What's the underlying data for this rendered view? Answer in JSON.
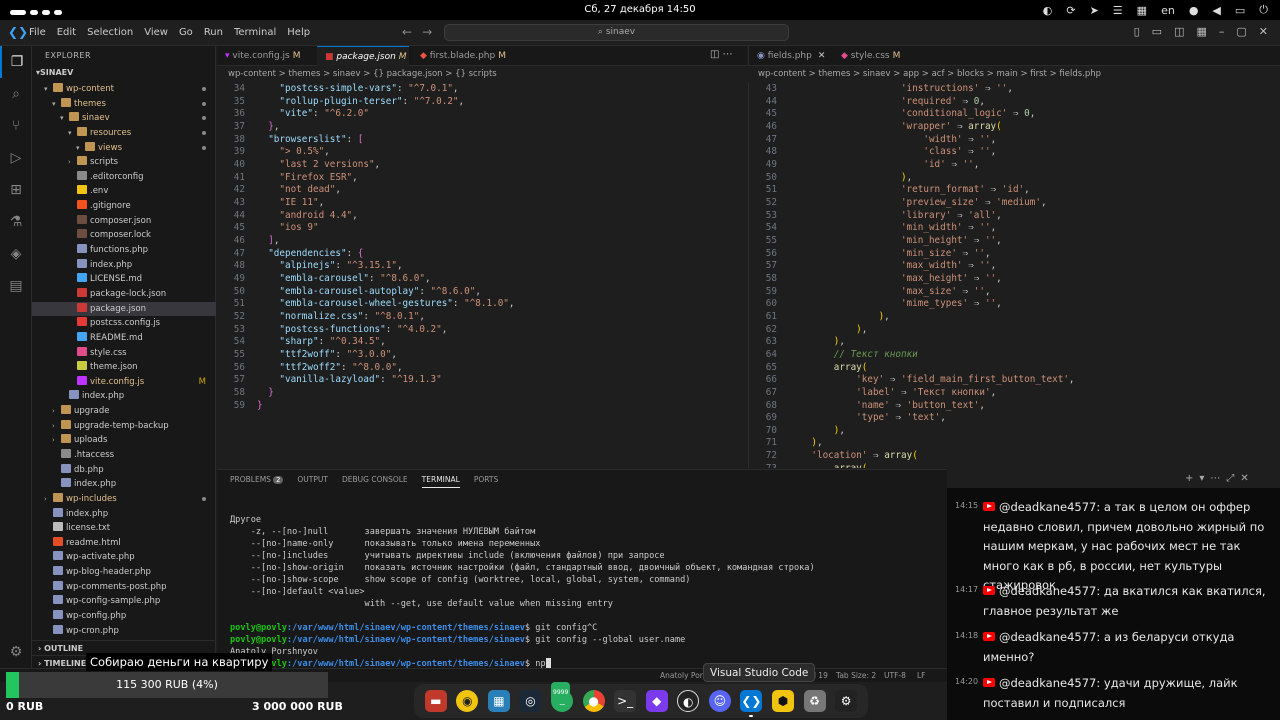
{
  "system": {
    "datetime": "Сб, 27 декабря 14:50",
    "lang": "en",
    "tray_icons": [
      "opera-icon",
      "refresh-icon",
      "telegram-icon",
      "equalizer-icon",
      "calendar-icon",
      "lang-indicator",
      "mic-icon",
      "volume-icon",
      "battery-icon",
      "power-icon"
    ]
  },
  "menubar": {
    "items": [
      "File",
      "Edit",
      "Selection",
      "View",
      "Go",
      "Run",
      "Terminal",
      "Help"
    ],
    "search": "sinaev"
  },
  "explorer": {
    "title": "EXPLORER",
    "root": "SINAEV",
    "rows": [
      {
        "label": "wp-content",
        "depth": 1,
        "type": "folder-open",
        "git": "mod",
        "dot": true
      },
      {
        "label": "themes",
        "depth": 2,
        "type": "folder-open",
        "git": "mod",
        "dot": true
      },
      {
        "label": "sinaev",
        "depth": 3,
        "type": "folder-open",
        "git": "mod",
        "dot": true
      },
      {
        "label": "resources",
        "depth": 4,
        "type": "folder-open",
        "git": "mod",
        "dot": true
      },
      {
        "label": "views",
        "depth": 5,
        "type": "folder-open",
        "git": "mod",
        "dot": true
      },
      {
        "label": "scripts",
        "depth": 4,
        "type": "folder",
        "git": ""
      },
      {
        "label": ".editorconfig",
        "depth": 4,
        "type": "file",
        "git": ""
      },
      {
        "label": ".env",
        "depth": 4,
        "type": "file-env",
        "git": ""
      },
      {
        "label": ".gitignore",
        "depth": 4,
        "type": "file-git",
        "git": ""
      },
      {
        "label": "composer.json",
        "depth": 4,
        "type": "file-composer",
        "git": ""
      },
      {
        "label": "composer.lock",
        "depth": 4,
        "type": "file-composer",
        "git": ""
      },
      {
        "label": "functions.php",
        "depth": 4,
        "type": "file-php",
        "git": ""
      },
      {
        "label": "index.php",
        "depth": 4,
        "type": "file-php",
        "git": ""
      },
      {
        "label": "LICENSE.md",
        "depth": 4,
        "type": "file-md",
        "git": ""
      },
      {
        "label": "package-lock.json",
        "depth": 4,
        "type": "file-npm",
        "git": ""
      },
      {
        "label": "package.json",
        "depth": 4,
        "type": "file-npm",
        "git": "",
        "selected": true
      },
      {
        "label": "postcss.config.js",
        "depth": 4,
        "type": "file-postcss",
        "git": ""
      },
      {
        "label": "README.md",
        "depth": 4,
        "type": "file-md",
        "git": ""
      },
      {
        "label": "style.css",
        "depth": 4,
        "type": "file-css",
        "git": ""
      },
      {
        "label": "theme.json",
        "depth": 4,
        "type": "file-json",
        "git": ""
      },
      {
        "label": "vite.config.js",
        "depth": 4,
        "type": "file-vite",
        "git": "mod",
        "mod": "M"
      },
      {
        "label": "index.php",
        "depth": 3,
        "type": "file-php",
        "git": ""
      },
      {
        "label": "upgrade",
        "depth": 2,
        "type": "folder",
        "git": ""
      },
      {
        "label": "upgrade-temp-backup",
        "depth": 2,
        "type": "folder",
        "git": ""
      },
      {
        "label": "uploads",
        "depth": 2,
        "type": "folder",
        "git": ""
      },
      {
        "label": ".htaccess",
        "depth": 2,
        "type": "file",
        "git": ""
      },
      {
        "label": "db.php",
        "depth": 2,
        "type": "file-php",
        "git": ""
      },
      {
        "label": "index.php",
        "depth": 2,
        "type": "file-php",
        "git": ""
      },
      {
        "label": "wp-includes",
        "depth": 1,
        "type": "folder",
        "git": "mod",
        "dot": true
      },
      {
        "label": "index.php",
        "depth": 1,
        "type": "file-php",
        "git": ""
      },
      {
        "label": "license.txt",
        "depth": 1,
        "type": "file-txt",
        "git": ""
      },
      {
        "label": "readme.html",
        "depth": 1,
        "type": "file-html",
        "git": ""
      },
      {
        "label": "wp-activate.php",
        "depth": 1,
        "type": "file-php",
        "git": ""
      },
      {
        "label": "wp-blog-header.php",
        "depth": 1,
        "type": "file-php",
        "git": ""
      },
      {
        "label": "wp-comments-post.php",
        "depth": 1,
        "type": "file-php",
        "git": ""
      },
      {
        "label": "wp-config-sample.php",
        "depth": 1,
        "type": "file-php",
        "git": ""
      },
      {
        "label": "wp-config.php",
        "depth": 1,
        "type": "file-php",
        "git": ""
      },
      {
        "label": "wp-cron.php",
        "depth": 1,
        "type": "file-php",
        "git": ""
      }
    ],
    "outline": "OUTLINE",
    "timeline": "TIMELINE"
  },
  "left_editor": {
    "tabs": [
      {
        "label": "vite.config.js",
        "mod": "M",
        "icon": "vite-icon"
      },
      {
        "label": "package.json",
        "mod": "M",
        "icon": "npm-icon",
        "active": true
      },
      {
        "label": "first.blade.php",
        "mod": "M",
        "icon": "blade-icon"
      }
    ],
    "breadcrumb": "wp-content > themes > sinaev > {} package.json > {} scripts",
    "lines": [
      {
        "n": "34",
        "t": "    \"postcss-simple-vars\": \"^7.0.1\","
      },
      {
        "n": "35",
        "t": "    \"rollup-plugin-terser\": \"^7.0.2\","
      },
      {
        "n": "36",
        "t": "    \"vite\": \"^6.2.0\""
      },
      {
        "n": "37",
        "t": "  },"
      },
      {
        "n": "38",
        "t": "  \"browserslist\": ["
      },
      {
        "n": "39",
        "t": "    \"> 0.5%\","
      },
      {
        "n": "40",
        "t": "    \"last 2 versions\","
      },
      {
        "n": "41",
        "t": "    \"Firefox ESR\","
      },
      {
        "n": "42",
        "t": "    \"not dead\","
      },
      {
        "n": "43",
        "t": "    \"IE 11\","
      },
      {
        "n": "44",
        "t": "    \"android 4.4\","
      },
      {
        "n": "45",
        "t": "    \"ios 9\""
      },
      {
        "n": "46",
        "t": "  ],"
      },
      {
        "n": "47",
        "t": "  \"dependencies\": {"
      },
      {
        "n": "48",
        "t": "    \"alpinejs\": \"^3.15.1\","
      },
      {
        "n": "49",
        "t": "    \"embla-carousel\": \"^8.6.0\","
      },
      {
        "n": "50",
        "t": "    \"embla-carousel-autoplay\": \"^8.6.0\","
      },
      {
        "n": "51",
        "t": "    \"embla-carousel-wheel-gestures\": \"^8.1.0\","
      },
      {
        "n": "52",
        "t": "    \"normalize.css\": \"^8.0.1\","
      },
      {
        "n": "53",
        "t": "    \"postcss-functions\": \"^4.0.2\","
      },
      {
        "n": "54",
        "t": "    \"sharp\": \"^0.34.5\","
      },
      {
        "n": "55",
        "t": "    \"ttf2woff\": \"^3.0.0\","
      },
      {
        "n": "56",
        "t": "    \"ttf2woff2\": \"^8.0.0\","
      },
      {
        "n": "57",
        "t": "    \"vanilla-lazyload\": \"^19.1.3\""
      },
      {
        "n": "58",
        "t": "  }"
      },
      {
        "n": "59",
        "t": "}"
      }
    ]
  },
  "right_editor": {
    "tabs": [
      {
        "label": "fields.php",
        "icon": "php-icon"
      },
      {
        "label": "style.css",
        "mod": "M",
        "icon": "css-icon"
      }
    ],
    "breadcrumb": "wp-content > themes > sinaev > app > acf > blocks > main > first > fields.php",
    "lines": [
      {
        "n": "43",
        "t": "                    'instructions' => '',"
      },
      {
        "n": "44",
        "t": "                    'required' => 0,"
      },
      {
        "n": "45",
        "t": "                    'conditional_logic' => 0,"
      },
      {
        "n": "46",
        "t": "                    'wrapper' => array("
      },
      {
        "n": "47",
        "t": "                        'width' => '',"
      },
      {
        "n": "48",
        "t": "                        'class' => '',"
      },
      {
        "n": "49",
        "t": "                        'id' => '',"
      },
      {
        "n": "50",
        "t": "                    ),"
      },
      {
        "n": "51",
        "t": "                    'return_format' => 'id',"
      },
      {
        "n": "52",
        "t": "                    'preview_size' => 'medium',"
      },
      {
        "n": "53",
        "t": "                    'library' => 'all',"
      },
      {
        "n": "54",
        "t": "                    'min_width' => '',"
      },
      {
        "n": "55",
        "t": "                    'min_height' => '',"
      },
      {
        "n": "56",
        "t": "                    'min_size' => '',"
      },
      {
        "n": "57",
        "t": "                    'max_width' => '',"
      },
      {
        "n": "58",
        "t": "                    'max_height' => '',"
      },
      {
        "n": "59",
        "t": "                    'max_size' => '',"
      },
      {
        "n": "60",
        "t": "                    'mime_types' => '',"
      },
      {
        "n": "61",
        "t": "                ),"
      },
      {
        "n": "62",
        "t": "            ),"
      },
      {
        "n": "63",
        "t": "        ),"
      },
      {
        "n": "64",
        "t": "        // Текст кнопки"
      },
      {
        "n": "65",
        "t": "        array("
      },
      {
        "n": "66",
        "t": "            'key' => 'field_main_first_button_text',"
      },
      {
        "n": "67",
        "t": "            'label' => 'Текст кнопки',"
      },
      {
        "n": "68",
        "t": "            'name' => 'button_text',"
      },
      {
        "n": "69",
        "t": "            'type' => 'text',"
      },
      {
        "n": "70",
        "t": "        ),"
      },
      {
        "n": "71",
        "t": "    ),"
      },
      {
        "n": "72",
        "t": "    'location' => array("
      },
      {
        "n": "73",
        "t": "        array("
      }
    ]
  },
  "panel": {
    "tabs": [
      "PROBLEMS",
      "OUTPUT",
      "DEBUG CONSOLE",
      "TERMINAL",
      "PORTS"
    ],
    "problems_count": "2",
    "active_tab": "TERMINAL",
    "terminal_lines": [
      {
        "kind": "text",
        "t": "Другое"
      },
      {
        "kind": "text",
        "t": "    -z, --[no-]null       завершать значения НУЛЕВЫМ байтом"
      },
      {
        "kind": "text",
        "t": "    --[no-]name-only      показывать только имена переменных"
      },
      {
        "kind": "text",
        "t": "    --[no-]includes       учитывать директивы include (включения файлов) при запросе"
      },
      {
        "kind": "text",
        "t": "    --[no-]show-origin    показать источник настройки (файл, стандартный ввод, двоичный объект, командная строка)"
      },
      {
        "kind": "text",
        "t": "    --[no-]show-scope     show scope of config (worktree, local, global, system, command)"
      },
      {
        "kind": "text",
        "t": "    --[no-]default <value>"
      },
      {
        "kind": "text",
        "t": "                          with --get, use default value when missing entry"
      },
      {
        "kind": "text",
        "t": ""
      },
      {
        "kind": "prompt",
        "user": "povly@povly",
        "path": ":/var/www/html/sinaev/wp-content/themes/sinaev",
        "cmd": "$ git config^C"
      },
      {
        "kind": "prompt",
        "user": "povly@povly",
        "path": ":/var/www/html/sinaev/wp-content/themes/sinaev",
        "cmd": "$ git config --global user.name"
      },
      {
        "kind": "text",
        "t": "Anatoly Porshnyov"
      },
      {
        "kind": "prompt",
        "user": "povly@povly",
        "path": ":/var/www/html/sinaev/wp-content/themes/sinaev",
        "cmd": "$ np",
        "cursor": true
      }
    ]
  },
  "statusbar": {
    "author": "Anatoly Por",
    "col": "Col 19",
    "tab_size": "Tab Size: 2",
    "encoding": "UTF-8",
    "eol": "LF"
  },
  "chat": {
    "messages": [
      {
        "time": "14:15",
        "user": "@deadkane4577:",
        "text": "а так в целом он оффер недавно словил, причем довольно жирный по нашим меркам, у нас рабочих мест не так много как в рб, в россии, нет культуры стажировок"
      },
      {
        "time": "14:17",
        "user": "@deadkane4577:",
        "text": "да вкатился как вкатился, главное результат же"
      },
      {
        "time": "14:18",
        "user": "@deadkane4577:",
        "text": "а из беларуси откуда именно?"
      },
      {
        "time": "14:20",
        "user": "@deadkane4577:",
        "text": "удачи дружище, лайк поставил и подписался"
      }
    ]
  },
  "donation": {
    "title": "Собираю деньги на квартиру",
    "amount": "115 300 RUB (4%)",
    "progress": 0.04,
    "min": "0 RUB",
    "max": "3 000 000 RUB"
  },
  "dock": {
    "apps": [
      "files-icon",
      "lens-icon",
      "store-icon",
      "steam-icon",
      "messenger-badge-icon",
      "chrome-icon",
      "terminal-icon",
      "obsidian-icon",
      "obs-icon",
      "discord-icon",
      "vscode-icon",
      "gamepad-icon",
      "trash-icon",
      "settings-icon"
    ],
    "badge": "9999",
    "tooltip": "Visual Studio Code"
  },
  "colors": {
    "accent": "#0078d4",
    "git_modified": "#e2c08d",
    "prompt_green": "#16c60c",
    "path_blue": "#3b8eea",
    "donation_fill": "#22c55e"
  }
}
